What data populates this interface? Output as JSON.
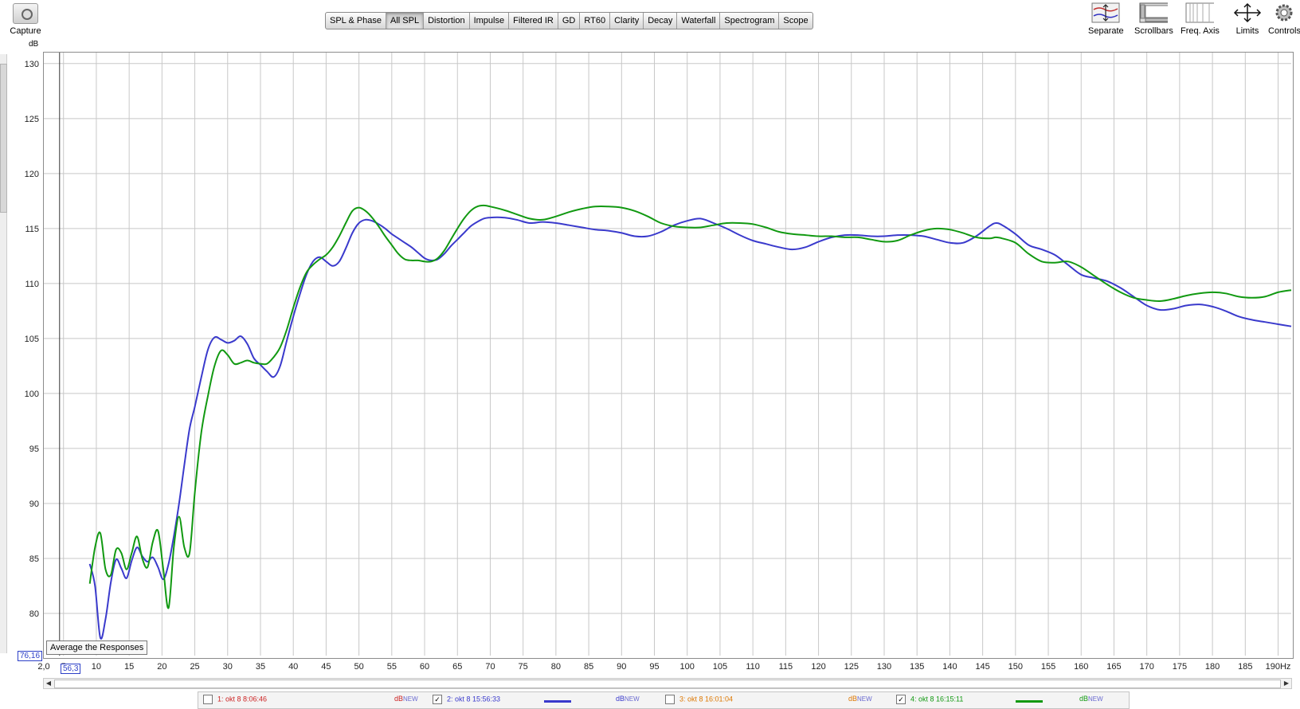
{
  "toolbar": {
    "capture_label": "Capture",
    "tabs": [
      {
        "label": "SPL & Phase",
        "active": false
      },
      {
        "label": "All SPL",
        "active": true
      },
      {
        "label": "Distortion",
        "active": false
      },
      {
        "label": "Impulse",
        "active": false
      },
      {
        "label": "Filtered IR",
        "active": false
      },
      {
        "label": "GD",
        "active": false
      },
      {
        "label": "RT60",
        "active": false
      },
      {
        "label": "Clarity",
        "active": false
      },
      {
        "label": "Decay",
        "active": false
      },
      {
        "label": "Waterfall",
        "active": false
      },
      {
        "label": "Spectrogram",
        "active": false
      },
      {
        "label": "Scope",
        "active": false
      }
    ],
    "right_tools": [
      {
        "label": "Separate",
        "icon": "separate-icon"
      },
      {
        "label": "Scrollbars",
        "icon": "scrollbars-icon"
      },
      {
        "label": "Freq. Axis",
        "icon": "freq-axis-icon"
      },
      {
        "label": "Limits",
        "icon": "limits-icon"
      },
      {
        "label": "Controls",
        "icon": "gear-icon"
      }
    ]
  },
  "plot": {
    "y_unit": "dB",
    "y_min_box": "76,16",
    "x_min_box": "56,3",
    "avg_tooltip": "Average the Responses",
    "cursor_hz": 4.4
  },
  "legend": [
    {
      "label": "1: okt 8 8:06:46",
      "checked": false,
      "color": "#cc2222",
      "db": "dB",
      "new": "NEW",
      "show_line": false
    },
    {
      "label": "2: okt 8 15:56:33",
      "checked": true,
      "color": "#3a3acc",
      "db": "dB",
      "new": "NEW",
      "show_line": true
    },
    {
      "label": "3: okt 8 16:01:04",
      "checked": false,
      "color": "#dd7700",
      "db": "dB",
      "new": "NEW",
      "show_line": false
    },
    {
      "label": "4: okt 8 16:15:11",
      "checked": true,
      "color": "#119911",
      "db": "dB",
      "new": "NEW",
      "show_line": true
    }
  ],
  "chart_data": {
    "type": "line",
    "xlabel": "Hz",
    "ylabel": "dB",
    "xlim": [
      2,
      192
    ],
    "ylim": [
      76.16,
      131
    ],
    "x_ticks": [
      "2,0",
      "5",
      "10",
      "15",
      "20",
      "25",
      "30",
      "35",
      "40",
      "45",
      "50",
      "55",
      "60",
      "65",
      "70",
      "75",
      "80",
      "85",
      "90",
      "95",
      "100",
      "105",
      "110",
      "115",
      "120",
      "125",
      "130",
      "135",
      "140",
      "145",
      "150",
      "155",
      "160",
      "165",
      "170",
      "175",
      "180",
      "185",
      "190Hz"
    ],
    "x_tick_values": [
      2,
      5,
      10,
      15,
      20,
      25,
      30,
      35,
      40,
      45,
      50,
      55,
      60,
      65,
      70,
      75,
      80,
      85,
      90,
      95,
      100,
      105,
      110,
      115,
      120,
      125,
      130,
      135,
      140,
      145,
      150,
      155,
      160,
      165,
      170,
      175,
      180,
      185,
      190
    ],
    "y_ticks": [
      80,
      85,
      90,
      95,
      100,
      105,
      110,
      115,
      120,
      125,
      130
    ],
    "grid": true,
    "series": [
      {
        "color": "#3a3acc",
        "x": [
          9,
          9.8,
          10.6,
          11.4,
          12.2,
          13,
          13.8,
          14.6,
          15.4,
          16.2,
          17,
          17.8,
          18.6,
          19.4,
          20.2,
          21,
          21.8,
          22.6,
          23.4,
          24.2,
          25,
          26,
          27,
          28,
          29,
          30,
          31,
          32,
          33,
          34,
          35,
          36,
          37,
          38,
          39,
          40,
          41,
          42,
          43,
          44,
          45,
          46,
          47,
          48,
          49,
          50,
          51,
          52,
          53,
          54,
          55,
          56,
          57,
          58,
          59,
          60,
          61,
          62,
          63,
          64,
          65,
          66,
          67,
          68,
          69,
          70,
          72,
          74,
          76,
          78,
          80,
          82,
          84,
          86,
          88,
          90,
          92,
          94,
          96,
          98,
          100,
          102,
          104,
          106,
          108,
          110,
          112,
          114,
          116,
          118,
          120,
          122,
          124,
          126,
          128,
          130,
          132,
          134,
          136,
          138,
          140,
          142,
          144,
          146,
          147,
          148,
          150,
          152,
          154,
          156,
          158,
          160,
          162,
          164,
          166,
          168,
          170,
          172,
          174,
          176,
          178,
          180,
          182,
          184,
          186,
          188,
          190,
          192
        ],
        "values": [
          84.5,
          82.5,
          77.8,
          79.5,
          82.8,
          84.9,
          84.1,
          83.2,
          84.8,
          86.0,
          85.2,
          84.7,
          85.1,
          84.2,
          83.1,
          84.5,
          87.0,
          90.0,
          93.5,
          96.8,
          98.8,
          101.5,
          104.0,
          105.1,
          104.9,
          104.6,
          104.8,
          105.2,
          104.5,
          103.2,
          102.6,
          102.0,
          101.5,
          102.5,
          104.8,
          107.0,
          109.0,
          110.8,
          112.0,
          112.4,
          112.0,
          111.6,
          112.0,
          113.2,
          114.6,
          115.5,
          115.8,
          115.7,
          115.4,
          115.0,
          114.5,
          114.1,
          113.7,
          113.3,
          112.8,
          112.3,
          112.1,
          112.2,
          112.7,
          113.4,
          114.0,
          114.6,
          115.2,
          115.6,
          115.9,
          116.0,
          116.0,
          115.8,
          115.5,
          115.6,
          115.5,
          115.3,
          115.1,
          114.9,
          114.8,
          114.6,
          114.3,
          114.3,
          114.7,
          115.3,
          115.7,
          115.9,
          115.5,
          115.0,
          114.4,
          113.9,
          113.6,
          113.3,
          113.1,
          113.3,
          113.8,
          114.2,
          114.4,
          114.4,
          114.3,
          114.3,
          114.4,
          114.4,
          114.3,
          114.0,
          113.7,
          113.7,
          114.3,
          115.2,
          115.5,
          115.3,
          114.5,
          113.5,
          113.1,
          112.6,
          111.7,
          110.8,
          110.5,
          110.2,
          109.6,
          108.8,
          108.0,
          107.6,
          107.7,
          108.0,
          108.1,
          107.9,
          107.5,
          107.0,
          106.7,
          106.5,
          106.3,
          106.1
        ]
      },
      {
        "color": "#119911",
        "x": [
          9,
          9.8,
          10.6,
          11.4,
          12.2,
          13,
          13.8,
          14.6,
          15.4,
          16.2,
          17,
          17.8,
          18.6,
          19.4,
          20.2,
          21,
          21.8,
          22.6,
          23.4,
          24.2,
          25,
          26,
          27,
          28,
          29,
          30,
          31,
          32,
          33,
          34,
          35,
          36,
          37,
          38,
          39,
          40,
          41,
          42,
          43,
          44,
          45,
          46,
          47,
          48,
          49,
          50,
          51,
          52,
          53,
          54,
          55,
          56,
          57,
          58,
          59,
          60,
          61,
          62,
          63,
          64,
          65,
          66,
          67,
          68,
          69,
          70,
          72,
          74,
          76,
          78,
          80,
          82,
          84,
          86,
          88,
          90,
          92,
          94,
          96,
          98,
          100,
          102,
          104,
          106,
          108,
          110,
          112,
          114,
          116,
          118,
          120,
          122,
          124,
          126,
          128,
          130,
          132,
          134,
          136,
          138,
          140,
          142,
          144,
          146,
          147,
          148,
          150,
          152,
          154,
          156,
          158,
          160,
          162,
          164,
          166,
          168,
          170,
          172,
          174,
          176,
          178,
          180,
          182,
          184,
          186,
          188,
          190,
          192
        ],
        "values": [
          82.7,
          86.0,
          87.3,
          84.0,
          83.5,
          85.8,
          85.5,
          84.0,
          85.5,
          87.0,
          85.0,
          84.2,
          86.5,
          87.5,
          84.0,
          80.5,
          86.0,
          88.8,
          86.0,
          85.5,
          91.0,
          96.5,
          99.8,
          102.5,
          103.9,
          103.5,
          102.7,
          102.8,
          103.0,
          102.8,
          102.7,
          102.7,
          103.3,
          104.2,
          105.8,
          107.8,
          109.6,
          111.0,
          111.7,
          112.2,
          112.6,
          113.3,
          114.3,
          115.5,
          116.6,
          116.9,
          116.6,
          116.0,
          115.2,
          114.3,
          113.5,
          112.7,
          112.2,
          112.1,
          112.1,
          112.0,
          112.0,
          112.3,
          113.0,
          114.0,
          115.0,
          115.9,
          116.6,
          117.0,
          117.1,
          117.0,
          116.7,
          116.3,
          115.9,
          115.8,
          116.1,
          116.5,
          116.8,
          117.0,
          117.0,
          116.9,
          116.6,
          116.1,
          115.5,
          115.2,
          115.1,
          115.1,
          115.3,
          115.5,
          115.5,
          115.4,
          115.1,
          114.7,
          114.5,
          114.4,
          114.3,
          114.3,
          114.2,
          114.2,
          114.0,
          113.8,
          113.9,
          114.4,
          114.8,
          115.0,
          114.9,
          114.6,
          114.2,
          114.1,
          114.2,
          114.1,
          113.7,
          112.7,
          112.0,
          111.9,
          112.0,
          111.5,
          110.7,
          109.9,
          109.2,
          108.7,
          108.5,
          108.4,
          108.6,
          108.9,
          109.1,
          109.2,
          109.1,
          108.8,
          108.7,
          108.8,
          109.2,
          109.4
        ]
      }
    ]
  }
}
